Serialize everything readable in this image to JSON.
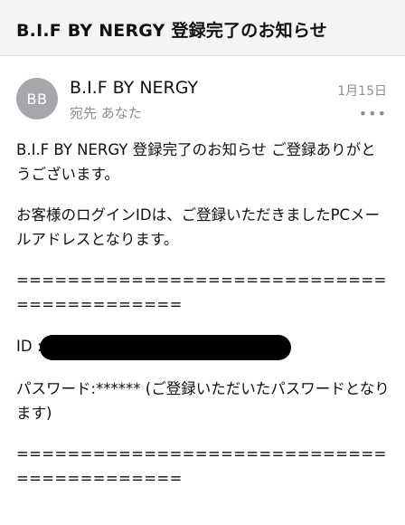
{
  "header": {
    "subject": "B.I.F BY NERGY 登録完了のお知らせ"
  },
  "message": {
    "avatar_initials": "BB",
    "sender": "B.I.F BY NERGY",
    "recipient": "宛先 あなた",
    "date": "1月15日",
    "more_icon": "more-horizontal-icon"
  },
  "body": {
    "p1": "B.I.F BY NERGY 登録完了のお知らせ ご登録ありがとうございます。",
    "p2": "お客様のログインIDは、ご登録いただきましたPCメールアドレスとなります。",
    "rule1": "==========================================",
    "id_label": "ID :",
    "password_text": "パスワード:****** (ご登録いただいたパスワードとなります)",
    "rule2": "=========================================="
  },
  "colors": {
    "header_bg": "#f4f4f4",
    "avatar_bg": "#a7a7ab",
    "secondary_text": "#8e8e93",
    "redaction": "#000000"
  }
}
